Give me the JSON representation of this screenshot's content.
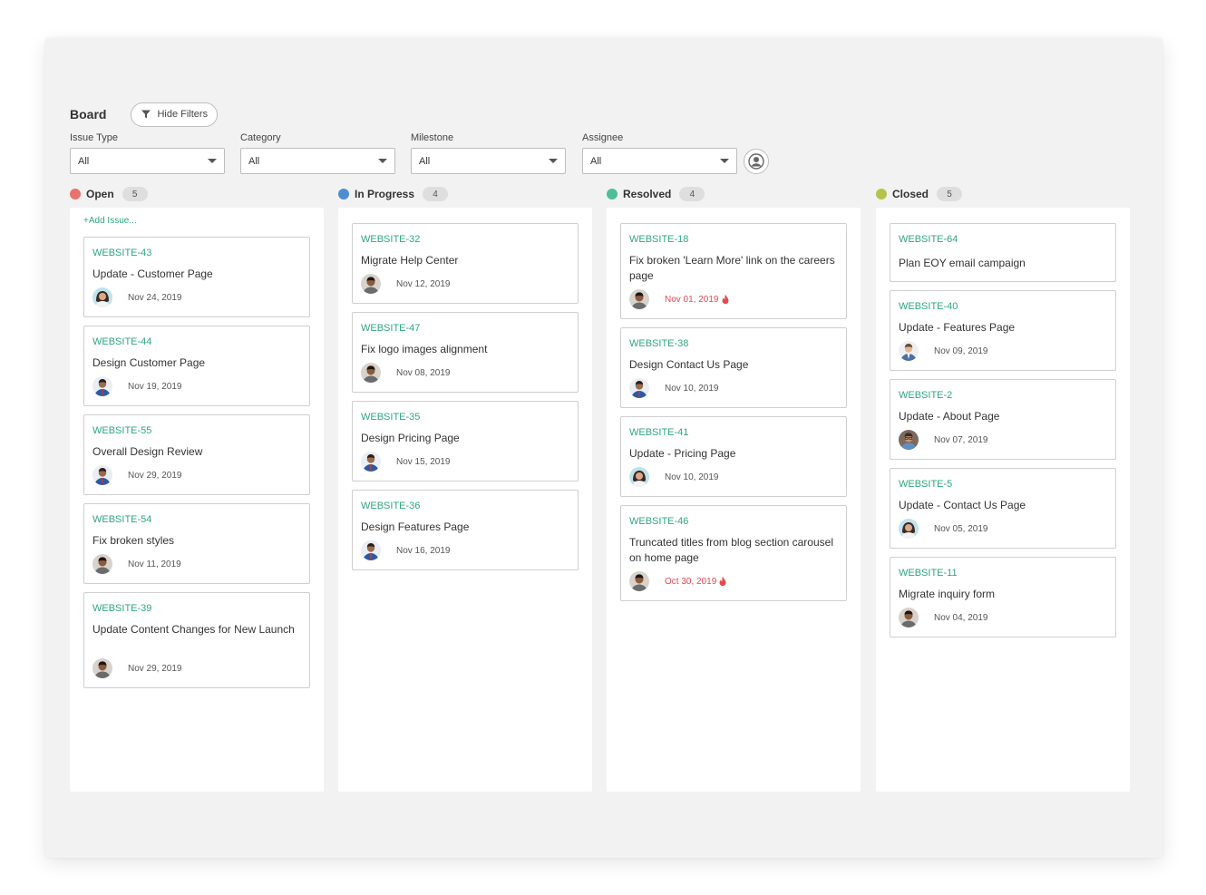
{
  "board": {
    "title": "Board",
    "hide_filters_label": "Hide Filters"
  },
  "filters": [
    {
      "label": "Issue Type",
      "value": "All"
    },
    {
      "label": "Category",
      "value": "All"
    },
    {
      "label": "Milestone",
      "value": "All"
    },
    {
      "label": "Assignee",
      "value": "All"
    }
  ],
  "colors": {
    "open": "#e8736c",
    "in_progress": "#4d8ed1",
    "resolved": "#4fbf97",
    "closed": "#b6c34a",
    "issue_id": "#2fa77f",
    "overdue": "#e5484d"
  },
  "columns": [
    {
      "title": "Open",
      "count": "5",
      "color": "#e8736c",
      "add_label": "+Add Issue...",
      "cards": [
        {
          "id": "WEBSITE-43",
          "title": "Update - Customer Page",
          "date": "Nov 24, 2019",
          "avatar": "avatar-woman",
          "overdue": false
        },
        {
          "id": "WEBSITE-44",
          "title": "Design Customer Page",
          "date": "Nov 19, 2019",
          "avatar": "avatar-man-blue",
          "overdue": false
        },
        {
          "id": "WEBSITE-55",
          "title": "Overall Design Review",
          "date": "Nov 29, 2019",
          "avatar": "avatar-man-blue",
          "overdue": false
        },
        {
          "id": "WEBSITE-54",
          "title": "Fix broken styles",
          "date": "Nov 11, 2019",
          "avatar": "avatar-man-dark",
          "overdue": false
        },
        {
          "id": "WEBSITE-39",
          "title": "Update Content Changes for New Launch",
          "date": "Nov 29, 2019",
          "avatar": "avatar-man-dark",
          "overdue": false
        }
      ]
    },
    {
      "title": "In Progress",
      "count": "4",
      "color": "#4d8ed1",
      "add_label": "",
      "cards": [
        {
          "id": "WEBSITE-32",
          "title": "Migrate Help Center",
          "date": "Nov 12, 2019",
          "avatar": "avatar-man-dark",
          "overdue": false
        },
        {
          "id": "WEBSITE-47",
          "title": "Fix logo images alignment",
          "date": "Nov 08, 2019",
          "avatar": "avatar-man-dark",
          "overdue": false
        },
        {
          "id": "WEBSITE-35",
          "title": "Design Pricing Page",
          "date": "Nov 15, 2019",
          "avatar": "avatar-man-blue",
          "overdue": false
        },
        {
          "id": "WEBSITE-36",
          "title": "Design Features Page",
          "date": "Nov 16, 2019",
          "avatar": "avatar-man-blue",
          "overdue": false
        }
      ]
    },
    {
      "title": "Resolved",
      "count": "4",
      "color": "#4fbf97",
      "add_label": "",
      "cards": [
        {
          "id": "WEBSITE-18",
          "title": "Fix broken 'Learn More' link on the careers page",
          "date": "Nov 01, 2019",
          "avatar": "avatar-man-dark",
          "overdue": true
        },
        {
          "id": "WEBSITE-38",
          "title": "Design Contact Us Page",
          "date": "Nov 10, 2019",
          "avatar": "avatar-man-blue",
          "overdue": false
        },
        {
          "id": "WEBSITE-41",
          "title": "Update - Pricing Page",
          "date": "Nov 10, 2019",
          "avatar": "avatar-woman",
          "overdue": false
        },
        {
          "id": "WEBSITE-46",
          "title": "Truncated titles from blog section carousel on home page",
          "date": "Oct 30, 2019",
          "avatar": "avatar-man-dark",
          "overdue": true
        }
      ]
    },
    {
      "title": "Closed",
      "count": "5",
      "color": "#b6c34a",
      "add_label": "",
      "cards": [
        {
          "id": "WEBSITE-64",
          "title": "Plan EOY email campaign",
          "date": "",
          "avatar": "",
          "overdue": false
        },
        {
          "id": "WEBSITE-40",
          "title": "Update - Features Page",
          "date": "Nov 09, 2019",
          "avatar": "avatar-man-light",
          "overdue": false
        },
        {
          "id": "WEBSITE-2",
          "title": "Update - About Page",
          "date": "Nov 07, 2019",
          "avatar": "avatar-man-glasses",
          "overdue": false
        },
        {
          "id": "WEBSITE-5",
          "title": "Update - Contact Us Page",
          "date": "Nov 05, 2019",
          "avatar": "avatar-woman",
          "overdue": false
        },
        {
          "id": "WEBSITE-11",
          "title": "Migrate inquiry form",
          "date": "Nov 04, 2019",
          "avatar": "avatar-man-dark",
          "overdue": false
        }
      ]
    }
  ]
}
